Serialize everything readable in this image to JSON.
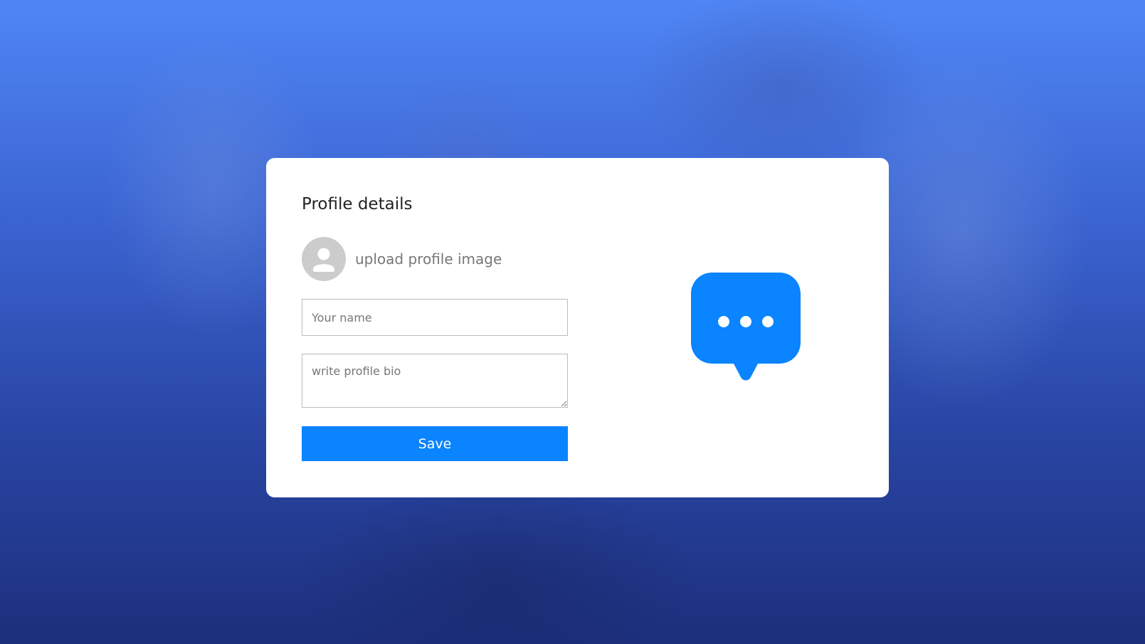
{
  "profile": {
    "title": "Profile details",
    "upload_label": "upload profile image",
    "avatar_icon": "user-placeholder-icon",
    "name_placeholder": "Your name",
    "name_value": "",
    "bio_placeholder": "write profile bio",
    "bio_value": "",
    "save_label": "Save"
  },
  "illustration": {
    "icon": "chat-bubble-icon",
    "color": "#0a84ff"
  },
  "colors": {
    "accent": "#0a84ff",
    "background_top": "#4f86f5",
    "background_bottom": "#1c2f7c",
    "card": "#ffffff"
  }
}
